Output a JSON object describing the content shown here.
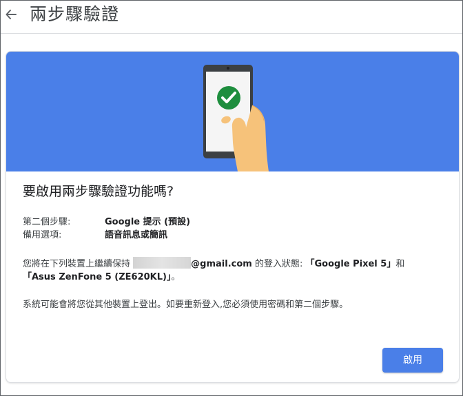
{
  "header": {
    "back_icon": "arrow-left-icon",
    "title": "兩步驟驗證"
  },
  "banner": {
    "color": "#4a7fe8",
    "icons": [
      "phone-icon",
      "checkmark-icon",
      "hand-icon"
    ]
  },
  "dialog": {
    "heading": "要啟用兩步驟驗證功能嗎?",
    "details": [
      {
        "label": "第二個步驟:",
        "value": "Google 提示 (預設)"
      },
      {
        "label": "備用選項:",
        "value": "語音訊息或簡訊"
      }
    ],
    "device_message": {
      "prefix": "您將在下列裝置上繼續保持",
      "email_suffix": "@gmail.com",
      "middle": " 的登入狀態:",
      "device1": "「Google Pixel 5」",
      "and": "和",
      "device2": "「Asus ZenFone 5 (ZE620KL)」",
      "end": "。"
    },
    "signout_message": "系統可能會將您從其他裝置上登出。如要重新登入,您必須使用密碼和第二個步驟。",
    "enable_button": "啟用"
  },
  "colors": {
    "accent": "#4a7fe8",
    "check": "#1e8e3e"
  }
}
